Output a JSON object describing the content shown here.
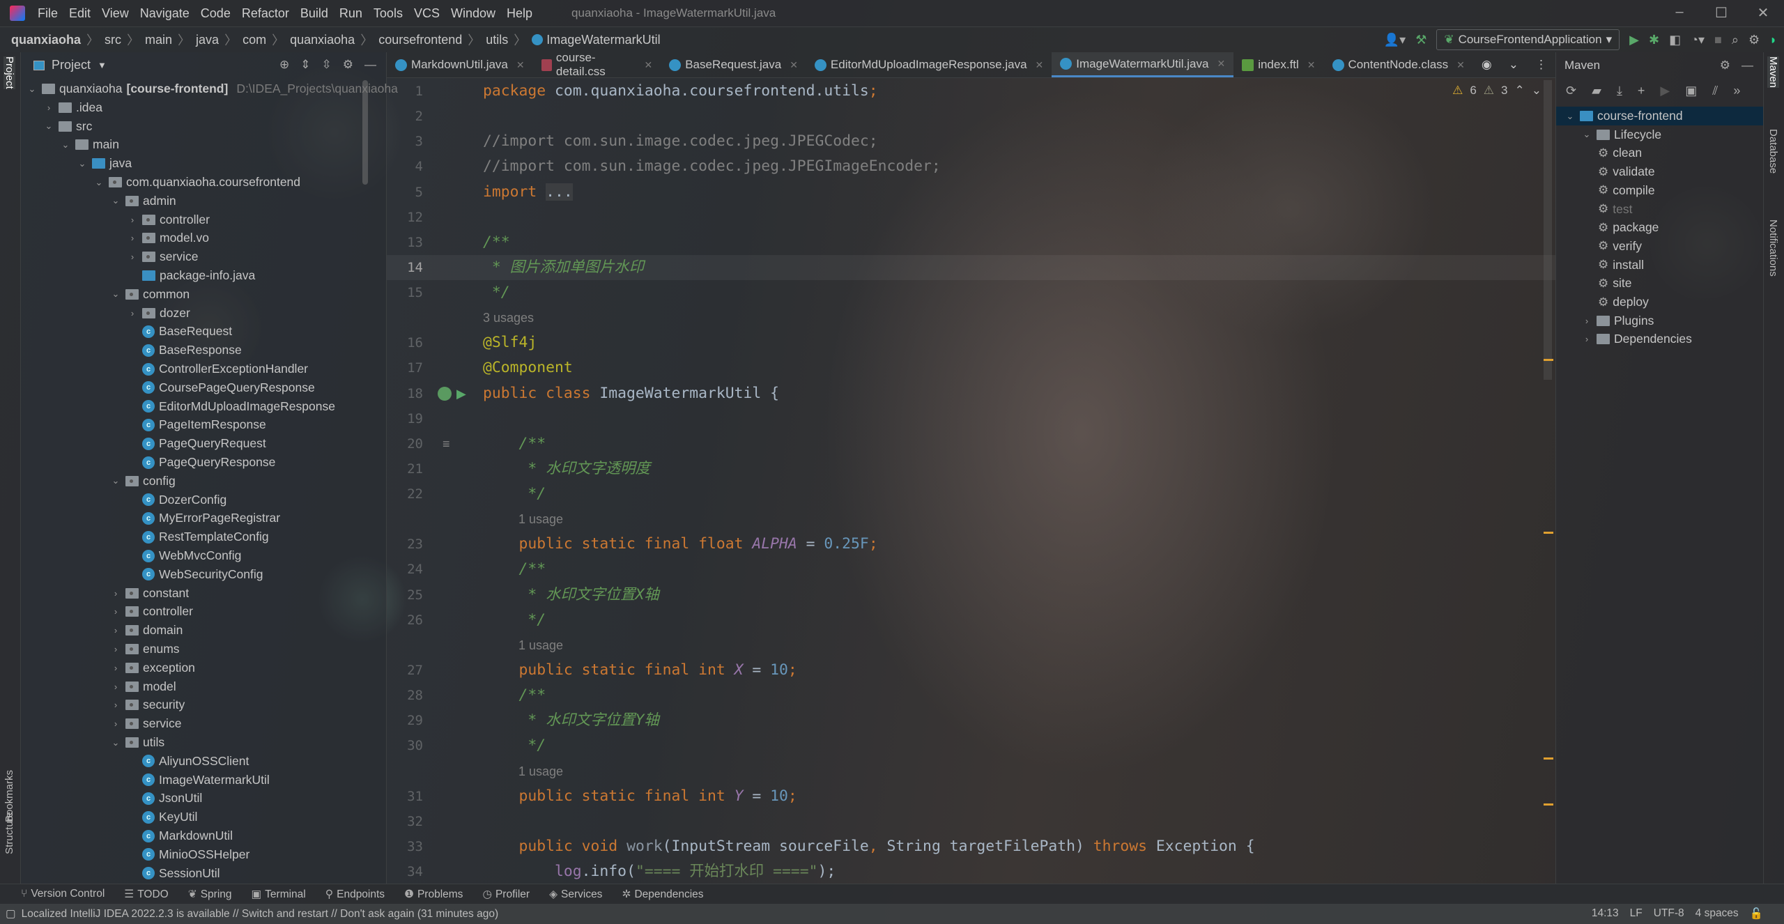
{
  "window": {
    "title": "quanxiaoha - ImageWatermarkUtil.java"
  },
  "menu": [
    "File",
    "Edit",
    "View",
    "Navigate",
    "Code",
    "Refactor",
    "Build",
    "Run",
    "Tools",
    "VCS",
    "Window",
    "Help"
  ],
  "breadcrumb": [
    "quanxiaoha",
    "src",
    "main",
    "java",
    "com",
    "quanxiaoha",
    "coursefrontend",
    "utils",
    "ImageWatermarkUtil"
  ],
  "toolbar": {
    "run_config": "CourseFrontendApplication"
  },
  "left_strip": {
    "project": "Project",
    "bookmarks": "Bookmarks",
    "structure": "Structure"
  },
  "right_strip": {
    "maven": "Maven",
    "database": "Database",
    "notifications": "Notifications"
  },
  "project": {
    "title": "Project",
    "tree": [
      {
        "label": "quanxiaoha",
        "bold": "[course-frontend]",
        "hint": "D:\\IDEA_Projects\\quanxiaoha",
        "depth": 0,
        "type": "module",
        "exp": "open"
      },
      {
        "label": ".idea",
        "depth": 1,
        "type": "folder",
        "exp": "closed"
      },
      {
        "label": "src",
        "depth": 1,
        "type": "folder",
        "exp": "open"
      },
      {
        "label": "main",
        "depth": 2,
        "type": "folder",
        "exp": "open"
      },
      {
        "label": "java",
        "depth": 3,
        "type": "src",
        "exp": "open"
      },
      {
        "label": "com.quanxiaoha.coursefrontend",
        "depth": 4,
        "type": "pkg",
        "exp": "open"
      },
      {
        "label": "admin",
        "depth": 5,
        "type": "pkg",
        "exp": "open"
      },
      {
        "label": "controller",
        "depth": 6,
        "type": "pkg",
        "exp": "closed"
      },
      {
        "label": "model.vo",
        "depth": 6,
        "type": "pkg",
        "exp": "closed"
      },
      {
        "label": "service",
        "depth": 6,
        "type": "pkg",
        "exp": "closed"
      },
      {
        "label": "package-info.java",
        "depth": 6,
        "type": "file"
      },
      {
        "label": "common",
        "depth": 5,
        "type": "pkg",
        "exp": "open"
      },
      {
        "label": "dozer",
        "depth": 6,
        "type": "pkg",
        "exp": "closed"
      },
      {
        "label": "BaseRequest",
        "depth": 6,
        "type": "class"
      },
      {
        "label": "BaseResponse",
        "depth": 6,
        "type": "class"
      },
      {
        "label": "ControllerExceptionHandler",
        "depth": 6,
        "type": "class"
      },
      {
        "label": "CoursePageQueryResponse",
        "depth": 6,
        "type": "class"
      },
      {
        "label": "EditorMdUploadImageResponse",
        "depth": 6,
        "type": "class"
      },
      {
        "label": "PageItemResponse",
        "depth": 6,
        "type": "class"
      },
      {
        "label": "PageQueryRequest",
        "depth": 6,
        "type": "class"
      },
      {
        "label": "PageQueryResponse",
        "depth": 6,
        "type": "class"
      },
      {
        "label": "config",
        "depth": 5,
        "type": "pkg",
        "exp": "open"
      },
      {
        "label": "DozerConfig",
        "depth": 6,
        "type": "class"
      },
      {
        "label": "MyErrorPageRegistrar",
        "depth": 6,
        "type": "class"
      },
      {
        "label": "RestTemplateConfig",
        "depth": 6,
        "type": "class"
      },
      {
        "label": "WebMvcConfig",
        "depth": 6,
        "type": "class"
      },
      {
        "label": "WebSecurityConfig",
        "depth": 6,
        "type": "class"
      },
      {
        "label": "constant",
        "depth": 5,
        "type": "pkg",
        "exp": "closed"
      },
      {
        "label": "controller",
        "depth": 5,
        "type": "pkg",
        "exp": "closed"
      },
      {
        "label": "domain",
        "depth": 5,
        "type": "pkg",
        "exp": "closed"
      },
      {
        "label": "enums",
        "depth": 5,
        "type": "pkg",
        "exp": "closed"
      },
      {
        "label": "exception",
        "depth": 5,
        "type": "pkg",
        "exp": "closed"
      },
      {
        "label": "model",
        "depth": 5,
        "type": "pkg",
        "exp": "closed"
      },
      {
        "label": "security",
        "depth": 5,
        "type": "pkg",
        "exp": "closed"
      },
      {
        "label": "service",
        "depth": 5,
        "type": "pkg",
        "exp": "closed"
      },
      {
        "label": "utils",
        "depth": 5,
        "type": "pkg",
        "exp": "open"
      },
      {
        "label": "AliyunOSSClient",
        "depth": 6,
        "type": "class"
      },
      {
        "label": "ImageWatermarkUtil",
        "depth": 6,
        "type": "class"
      },
      {
        "label": "JsonUtil",
        "depth": 6,
        "type": "class"
      },
      {
        "label": "KeyUtil",
        "depth": 6,
        "type": "class"
      },
      {
        "label": "MarkdownUtil",
        "depth": 6,
        "type": "class"
      },
      {
        "label": "MinioOSSHelper",
        "depth": 6,
        "type": "class"
      },
      {
        "label": "SessionUtil",
        "depth": 6,
        "type": "class"
      }
    ]
  },
  "tabs": [
    {
      "label": "MarkdownUtil.java",
      "icon": "java"
    },
    {
      "label": "course-detail.css",
      "icon": "css"
    },
    {
      "label": "BaseRequest.java",
      "icon": "java"
    },
    {
      "label": "EditorMdUploadImageResponse.java",
      "icon": "java"
    },
    {
      "label": "ImageWatermarkUtil.java",
      "icon": "java",
      "active": true
    },
    {
      "label": "index.ftl",
      "icon": "ftl"
    },
    {
      "label": "ContentNode.class",
      "icon": "java"
    }
  ],
  "inspections": {
    "warnings": "6",
    "weak_warnings": "3"
  },
  "code": [
    {
      "n": "1",
      "t": [
        [
          "package",
          "kw"
        ],
        [
          " com.quanxiaoha.coursefrontend.utils",
          ""
        ],
        [
          ";",
          "kw"
        ]
      ]
    },
    {
      "n": "2",
      "t": []
    },
    {
      "n": "3",
      "t": [
        [
          "//import com.sun.image.codec.jpeg.JPEGCodec;",
          "cm"
        ]
      ]
    },
    {
      "n": "4",
      "t": [
        [
          "//import com.sun.image.codec.jpeg.JPEGImageEncoder;",
          "cm"
        ]
      ]
    },
    {
      "n": "5",
      "t": [
        [
          "import",
          "kw"
        ],
        [
          " ",
          ""
        ],
        [
          "...",
          "fold"
        ]
      ]
    },
    {
      "n": "12",
      "t": []
    },
    {
      "n": "13",
      "t": [
        [
          "/**",
          "doc"
        ]
      ]
    },
    {
      "n": "14",
      "cur": true,
      "t": [
        [
          " * 图片添加单图片水印",
          "doc"
        ]
      ]
    },
    {
      "n": "15",
      "t": [
        [
          " */",
          "doc"
        ]
      ]
    },
    {
      "hint": "3 usages",
      "indent": 0
    },
    {
      "n": "16",
      "t": [
        [
          "@Slf4j",
          "ann"
        ]
      ]
    },
    {
      "n": "17",
      "t": [
        [
          "@Component",
          "ann"
        ]
      ]
    },
    {
      "n": "18",
      "t": [
        [
          "public class ",
          "kw"
        ],
        [
          "ImageWatermarkUtil {",
          ""
        ]
      ]
    },
    {
      "n": "19",
      "t": []
    },
    {
      "n": "20",
      "t": [
        [
          "    /**",
          "doc"
        ]
      ]
    },
    {
      "n": "21",
      "t": [
        [
          "     * 水印文字透明度",
          "doc"
        ]
      ]
    },
    {
      "n": "22",
      "t": [
        [
          "     */",
          "doc"
        ]
      ]
    },
    {
      "hint": "1 usage",
      "indent": 1
    },
    {
      "n": "23",
      "t": [
        [
          "    public static final float ",
          "kw"
        ],
        [
          "ALPHA",
          "const"
        ],
        [
          " = ",
          ""
        ],
        [
          "0.25F",
          "num"
        ],
        [
          ";",
          "kw"
        ]
      ]
    },
    {
      "n": "24",
      "t": [
        [
          "    /**",
          "doc"
        ]
      ]
    },
    {
      "n": "25",
      "t": [
        [
          "     * 水印文字位置X轴",
          "doc"
        ]
      ]
    },
    {
      "n": "26",
      "t": [
        [
          "     */",
          "doc"
        ]
      ]
    },
    {
      "hint": "1 usage",
      "indent": 1
    },
    {
      "n": "27",
      "t": [
        [
          "    public static final int ",
          "kw"
        ],
        [
          "X",
          "const"
        ],
        [
          " = ",
          ""
        ],
        [
          "10",
          "num"
        ],
        [
          ";",
          "kw"
        ]
      ]
    },
    {
      "n": "28",
      "t": [
        [
          "    /**",
          "doc"
        ]
      ]
    },
    {
      "n": "29",
      "t": [
        [
          "     * 水印文字位置Y轴",
          "doc"
        ]
      ]
    },
    {
      "n": "30",
      "t": [
        [
          "     */",
          "doc"
        ]
      ]
    },
    {
      "hint": "1 usage",
      "indent": 1
    },
    {
      "n": "31",
      "t": [
        [
          "    public static final int ",
          "kw"
        ],
        [
          "Y",
          "const"
        ],
        [
          " = ",
          ""
        ],
        [
          "10",
          "num"
        ],
        [
          ";",
          "kw"
        ]
      ]
    },
    {
      "n": "32",
      "t": []
    },
    {
      "n": "33",
      "t": [
        [
          "    public void ",
          "kw"
        ],
        [
          "work",
          "fn"
        ],
        [
          "(InputStream sourceFile",
          ""
        ],
        [
          ", ",
          "kw"
        ],
        [
          "String targetFilePath) ",
          ""
        ],
        [
          "throws ",
          "kw"
        ],
        [
          "Exception {",
          ""
        ]
      ]
    },
    {
      "n": "34",
      "t": [
        [
          "        ",
          ""
        ],
        [
          "log",
          "lg"
        ],
        [
          ".info(",
          ""
        ],
        [
          "\"==== 开始打水印 ====\"",
          "str"
        ],
        [
          ");",
          ""
        ]
      ]
    }
  ],
  "maven": {
    "title": "Maven",
    "tree": [
      {
        "label": "course-frontend",
        "depth": 0,
        "exp": "open",
        "type": "module",
        "sel": true
      },
      {
        "label": "Lifecycle",
        "depth": 1,
        "exp": "open",
        "type": "folder"
      },
      {
        "label": "clean",
        "depth": 2,
        "type": "goal"
      },
      {
        "label": "validate",
        "depth": 2,
        "type": "goal"
      },
      {
        "label": "compile",
        "depth": 2,
        "type": "goal"
      },
      {
        "label": "test",
        "depth": 2,
        "type": "goal",
        "dim": true
      },
      {
        "label": "package",
        "depth": 2,
        "type": "goal"
      },
      {
        "label": "verify",
        "depth": 2,
        "type": "goal"
      },
      {
        "label": "install",
        "depth": 2,
        "type": "goal"
      },
      {
        "label": "site",
        "depth": 2,
        "type": "goal"
      },
      {
        "label": "deploy",
        "depth": 2,
        "type": "goal"
      },
      {
        "label": "Plugins",
        "depth": 1,
        "exp": "closed",
        "type": "folder"
      },
      {
        "label": "Dependencies",
        "depth": 1,
        "exp": "closed",
        "type": "folder"
      }
    ]
  },
  "bottom_tools": [
    {
      "label": "Version Control",
      "icon": "⑂"
    },
    {
      "label": "TODO",
      "icon": "☰"
    },
    {
      "label": "Spring",
      "icon": "❦"
    },
    {
      "label": "Terminal",
      "icon": "▣"
    },
    {
      "label": "Endpoints",
      "icon": "⚲"
    },
    {
      "label": "Problems",
      "icon": "❶"
    },
    {
      "label": "Profiler",
      "icon": "◷"
    },
    {
      "label": "Services",
      "icon": "◈"
    },
    {
      "label": "Dependencies",
      "icon": "✲"
    }
  ],
  "status": {
    "message": "Localized IntelliJ IDEA 2022.2.3 is available // Switch and restart // Don't ask again (31 minutes ago)",
    "position": "14:13",
    "line_sep": "LF",
    "encoding": "UTF-8",
    "indent": "4 spaces"
  }
}
